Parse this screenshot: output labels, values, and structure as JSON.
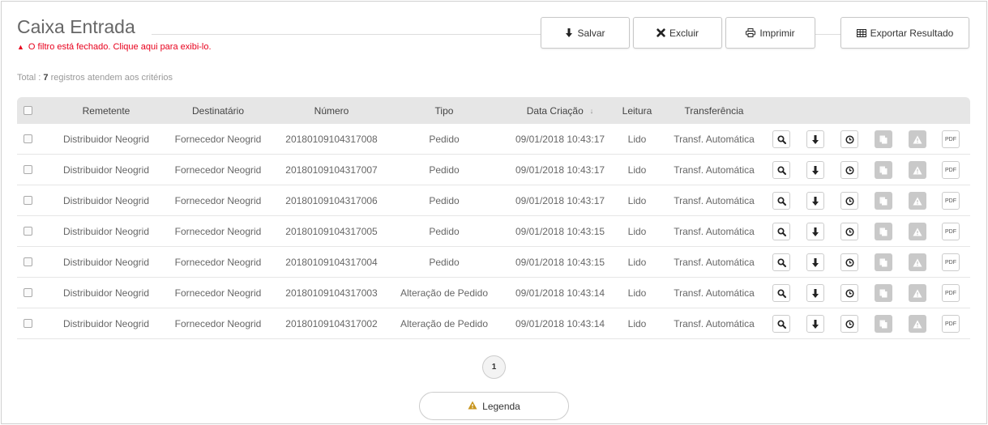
{
  "header": {
    "title": "Caixa Entrada",
    "filter_note": "O filtro está fechado. Clique aqui para exibi-lo."
  },
  "toolbar": {
    "salvar": "Salvar",
    "excluir": "Excluir",
    "imprimir": "Imprimir",
    "exportar": "Exportar Resultado"
  },
  "summary": {
    "prefix": "Total :",
    "count": "7",
    "suffix": "registros atendem aos critérios"
  },
  "table": {
    "columns": {
      "remetente": "Remetente",
      "destinatario": "Destinatário",
      "numero": "Número",
      "tipo": "Tipo",
      "data": "Data Criação",
      "leitura": "Leitura",
      "transferencia": "Transferência"
    },
    "rows": [
      {
        "remetente": "Distribuidor Neogrid",
        "destinatario": "Fornecedor Neogrid",
        "numero": "20180109104317008",
        "tipo": "Pedido",
        "data": "09/01/2018 10:43:17",
        "leitura": "Lido",
        "transferencia": "Transf. Automática"
      },
      {
        "remetente": "Distribuidor Neogrid",
        "destinatario": "Fornecedor Neogrid",
        "numero": "20180109104317007",
        "tipo": "Pedido",
        "data": "09/01/2018 10:43:17",
        "leitura": "Lido",
        "transferencia": "Transf. Automática"
      },
      {
        "remetente": "Distribuidor Neogrid",
        "destinatario": "Fornecedor Neogrid",
        "numero": "20180109104317006",
        "tipo": "Pedido",
        "data": "09/01/2018 10:43:17",
        "leitura": "Lido",
        "transferencia": "Transf. Automática"
      },
      {
        "remetente": "Distribuidor Neogrid",
        "destinatario": "Fornecedor Neogrid",
        "numero": "20180109104317005",
        "tipo": "Pedido",
        "data": "09/01/2018 10:43:15",
        "leitura": "Lido",
        "transferencia": "Transf. Automática"
      },
      {
        "remetente": "Distribuidor Neogrid",
        "destinatario": "Fornecedor Neogrid",
        "numero": "20180109104317004",
        "tipo": "Pedido",
        "data": "09/01/2018 10:43:15",
        "leitura": "Lido",
        "transferencia": "Transf. Automática"
      },
      {
        "remetente": "Distribuidor Neogrid",
        "destinatario": "Fornecedor Neogrid",
        "numero": "20180109104317003",
        "tipo": "Alteração de Pedido",
        "data": "09/01/2018 10:43:14",
        "leitura": "Lido",
        "transferencia": "Transf. Automática"
      },
      {
        "remetente": "Distribuidor Neogrid",
        "destinatario": "Fornecedor Neogrid",
        "numero": "20180109104317002",
        "tipo": "Alteração de Pedido",
        "data": "09/01/2018 10:43:14",
        "leitura": "Lido",
        "transferencia": "Transf. Automática"
      }
    ],
    "row_actions": {
      "icons": [
        "search-icon",
        "download-icon",
        "clock-icon",
        "copy-icon",
        "warning-icon",
        "pdf-icon"
      ],
      "pdf_label": "PDF"
    }
  },
  "pagination": {
    "current_page": "1"
  },
  "legend_button": {
    "label": "Legenda"
  },
  "colors": {
    "accent_red": "#e8001c",
    "header_bg": "#e6e6e6",
    "disabled_icon_bg": "#c9c9c9"
  }
}
